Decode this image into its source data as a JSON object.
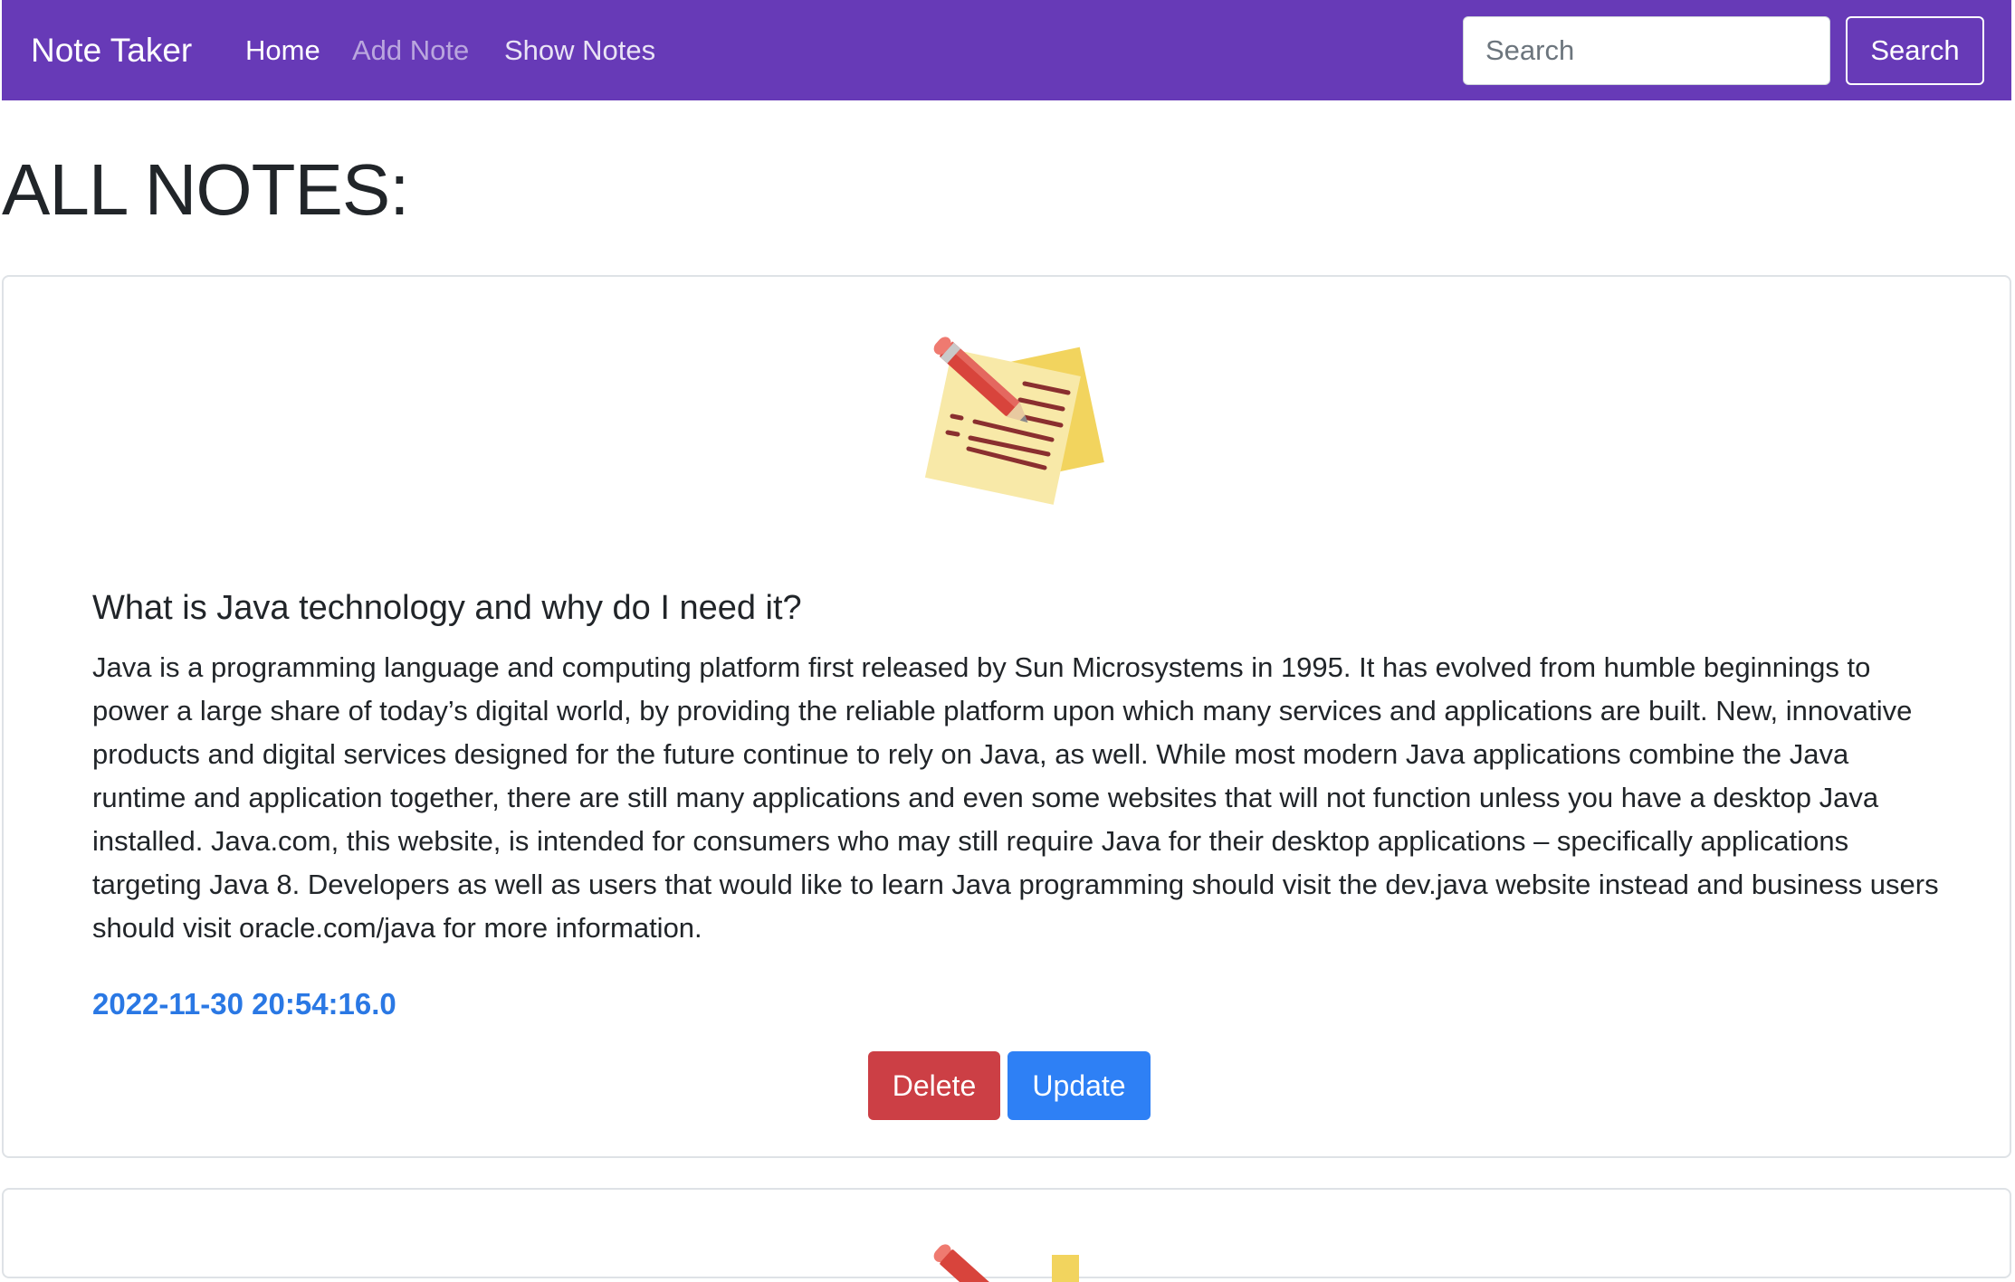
{
  "navbar": {
    "brand": "Note Taker",
    "links": [
      {
        "label": "Home",
        "state": "active"
      },
      {
        "label": "Add Note",
        "state": "muted"
      },
      {
        "label": "Show Notes",
        "state": "normal"
      }
    ],
    "search": {
      "placeholder": "Search",
      "value": "",
      "button_label": "Search"
    },
    "color": "#673ab7"
  },
  "page": {
    "title": "ALL NOTES:"
  },
  "notes": [
    {
      "image": "sticky-note-pencil-icon",
      "title": "What is Java technology and why do I need it?",
      "content": "Java is a programming language and computing platform first released by Sun Microsystems in 1995. It has evolved from humble beginnings to power a large share of today’s digital world, by providing the reliable platform upon which many services and applications are built. New, innovative products and digital services designed for the future continue to rely on Java, as well. While most modern Java applications combine the Java runtime and application together, there are still many applications and even some websites that will not function unless you have a desktop Java installed. Java.com, this website, is intended for consumers who may still require Java for their desktop applications – specifically applications targeting Java 8. Developers as well as users that would like to learn Java programming should visit the dev.java website instead and business users should visit oracle.com/java for more information.",
      "date": "2022-11-30 20:54:16.0",
      "delete_label": "Delete",
      "update_label": "Update"
    }
  ],
  "colors": {
    "delete": "#cc3f45",
    "update": "#2e80f5",
    "date": "#2a78e4"
  }
}
